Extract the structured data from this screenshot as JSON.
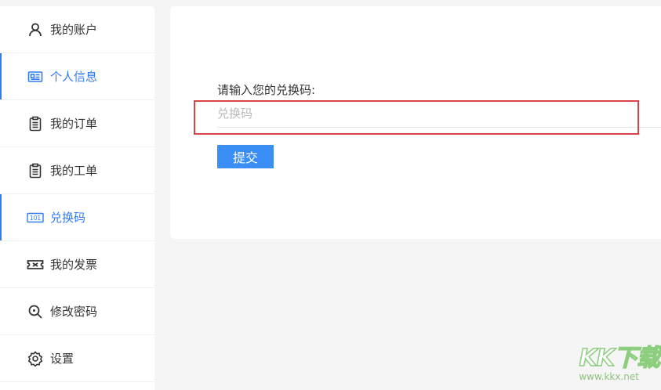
{
  "sidebar": {
    "items": [
      {
        "label": "我的账户",
        "icon": "user-icon",
        "active": false
      },
      {
        "label": "个人信息",
        "icon": "id-card-icon",
        "active": true
      },
      {
        "label": "我的订单",
        "icon": "clipboard-icon",
        "active": false
      },
      {
        "label": "我的工单",
        "icon": "clipboard-icon",
        "active": false
      },
      {
        "label": "兑换码",
        "icon": "redeem-code-icon",
        "active": false
      },
      {
        "label": "我的发票",
        "icon": "ticket-icon",
        "active": false
      },
      {
        "label": "修改密码",
        "icon": "search-key-icon",
        "active": false
      },
      {
        "label": "设置",
        "icon": "gear-icon",
        "active": false
      }
    ],
    "accent_color": "#2f7cf6"
  },
  "redeem": {
    "prompt": "请输入您的兑换码:",
    "input_placeholder": "兑换码",
    "input_value": "",
    "submit_label": "提交",
    "button_color": "#3a8ef6",
    "highlight_color": "#d9434a"
  },
  "watermark": {
    "logo": "KK下载",
    "url": "www.kkx.net"
  }
}
